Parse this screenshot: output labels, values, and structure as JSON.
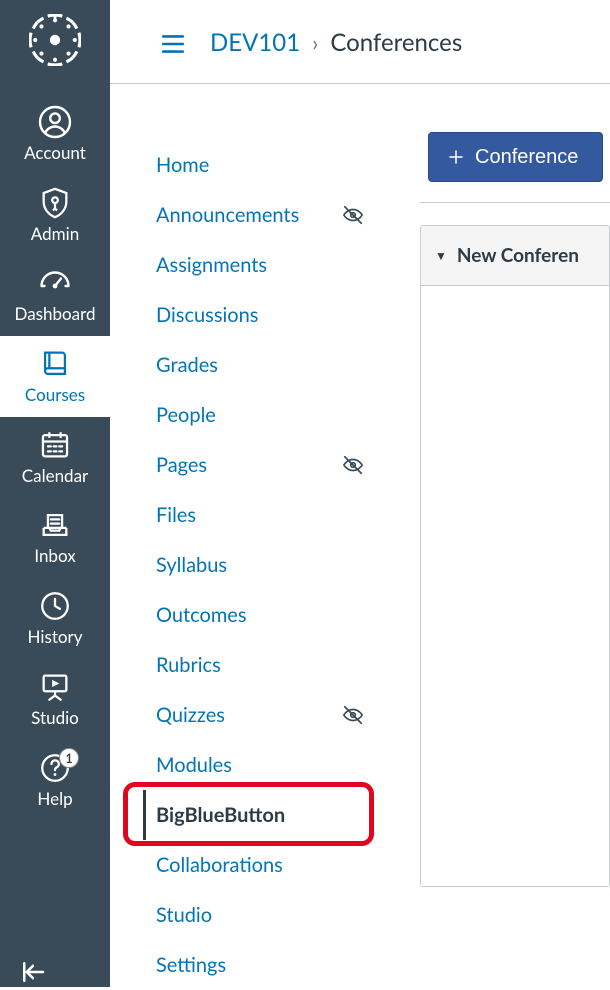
{
  "breadcrumb": {
    "course": "DEV101",
    "current": "Conferences"
  },
  "globalNav": {
    "items": [
      {
        "key": "account",
        "label": "Account"
      },
      {
        "key": "admin",
        "label": "Admin"
      },
      {
        "key": "dashboard",
        "label": "Dashboard"
      },
      {
        "key": "courses",
        "label": "Courses",
        "active": true
      },
      {
        "key": "calendar",
        "label": "Calendar"
      },
      {
        "key": "inbox",
        "label": "Inbox"
      },
      {
        "key": "history",
        "label": "History"
      },
      {
        "key": "studio",
        "label": "Studio"
      },
      {
        "key": "help",
        "label": "Help",
        "badge": "1"
      }
    ]
  },
  "courseNav": {
    "items": [
      {
        "label": "Home"
      },
      {
        "label": "Announcements",
        "hidden": true
      },
      {
        "label": "Assignments"
      },
      {
        "label": "Discussions"
      },
      {
        "label": "Grades"
      },
      {
        "label": "People"
      },
      {
        "label": "Pages",
        "hidden": true
      },
      {
        "label": "Files"
      },
      {
        "label": "Syllabus"
      },
      {
        "label": "Outcomes"
      },
      {
        "label": "Rubrics"
      },
      {
        "label": "Quizzes",
        "hidden": true
      },
      {
        "label": "Modules"
      },
      {
        "label": "BigBlueButton",
        "current": true,
        "highlighted": true
      },
      {
        "label": "Collaborations"
      },
      {
        "label": "Studio"
      },
      {
        "label": "Settings"
      }
    ]
  },
  "main": {
    "addButtonLabel": "Conference",
    "sectionTitle": "New Conferen"
  },
  "helpBadge": "1"
}
